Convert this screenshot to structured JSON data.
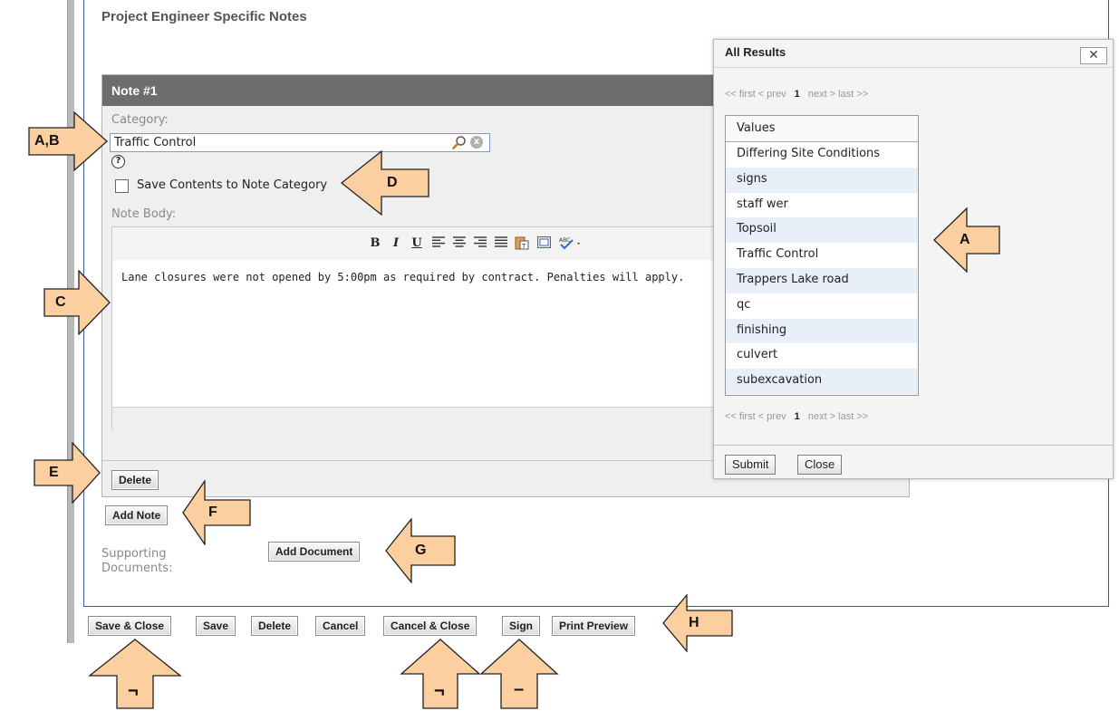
{
  "section_title": "Project Engineer Specific Notes",
  "note": {
    "header": "Note #1",
    "category_label": "Category:",
    "category_value": "Traffic Control",
    "help_icon": "?",
    "clear_icon": "x",
    "save_contents_label": "Save Contents to Note Category",
    "note_body_label": "Note Body:",
    "toolbar": {
      "bold": "B",
      "italic": "I",
      "underline": "U"
    },
    "body_text": "Lane closures were not opened by 5:00pm as required by contract.  Penalties will apply.",
    "delete_label": "Delete"
  },
  "add_note_label": "Add Note",
  "supporting_documents_label": "Supporting Documents:",
  "add_document_label": "Add Document",
  "bottom_buttons": {
    "save_close": "Save & Close",
    "save": "Save",
    "delete": "Delete",
    "cancel": "Cancel",
    "cancel_close": "Cancel & Close",
    "sign": "Sign",
    "print_preview": "Print Preview"
  },
  "popup": {
    "title": "All Results",
    "close_icon": "✕",
    "pager": {
      "first": "<< first",
      "prev": "< prev",
      "current": "1",
      "next": "next >",
      "last": "last >>"
    },
    "values_header": "Values",
    "values": [
      "Differing Site Conditions",
      "signs",
      "staff wer",
      "Topsoil",
      "Traffic Control",
      "Trappers Lake road",
      "qc",
      "finishing",
      "culvert",
      "subexcavation"
    ],
    "submit_label": "Submit",
    "close_label": "Close"
  },
  "callouts": {
    "ab": "A,B",
    "a": "A",
    "c": "C",
    "d": "D",
    "e": "E",
    "f": "F",
    "g": "G",
    "h": "H",
    "up1": "¬",
    "up2": "¬",
    "up3": "–"
  },
  "colors": {
    "callout_fill": "#fbcf9f",
    "header_bg": "#6d6d6d",
    "frame_blue": "#3a5ba8",
    "row_alt": "#e8eff9"
  }
}
